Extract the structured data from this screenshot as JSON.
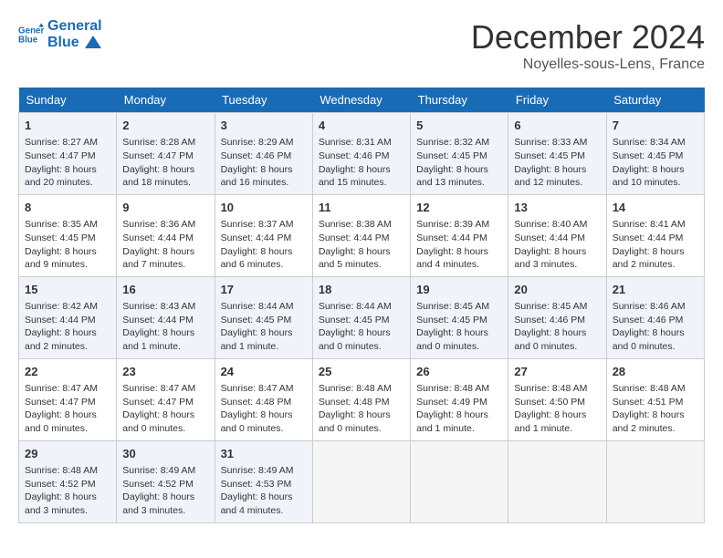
{
  "header": {
    "logo_line1": "General",
    "logo_line2": "Blue",
    "month": "December 2024",
    "location": "Noyelles-sous-Lens, France"
  },
  "days_of_week": [
    "Sunday",
    "Monday",
    "Tuesday",
    "Wednesday",
    "Thursday",
    "Friday",
    "Saturday"
  ],
  "weeks": [
    [
      {
        "day": "1",
        "sunrise": "8:27 AM",
        "sunset": "4:47 PM",
        "daylight": "8 hours and 20 minutes."
      },
      {
        "day": "2",
        "sunrise": "8:28 AM",
        "sunset": "4:47 PM",
        "daylight": "8 hours and 18 minutes."
      },
      {
        "day": "3",
        "sunrise": "8:29 AM",
        "sunset": "4:46 PM",
        "daylight": "8 hours and 16 minutes."
      },
      {
        "day": "4",
        "sunrise": "8:31 AM",
        "sunset": "4:46 PM",
        "daylight": "8 hours and 15 minutes."
      },
      {
        "day": "5",
        "sunrise": "8:32 AM",
        "sunset": "4:45 PM",
        "daylight": "8 hours and 13 minutes."
      },
      {
        "day": "6",
        "sunrise": "8:33 AM",
        "sunset": "4:45 PM",
        "daylight": "8 hours and 12 minutes."
      },
      {
        "day": "7",
        "sunrise": "8:34 AM",
        "sunset": "4:45 PM",
        "daylight": "8 hours and 10 minutes."
      }
    ],
    [
      {
        "day": "8",
        "sunrise": "8:35 AM",
        "sunset": "4:45 PM",
        "daylight": "8 hours and 9 minutes."
      },
      {
        "day": "9",
        "sunrise": "8:36 AM",
        "sunset": "4:44 PM",
        "daylight": "8 hours and 7 minutes."
      },
      {
        "day": "10",
        "sunrise": "8:37 AM",
        "sunset": "4:44 PM",
        "daylight": "8 hours and 6 minutes."
      },
      {
        "day": "11",
        "sunrise": "8:38 AM",
        "sunset": "4:44 PM",
        "daylight": "8 hours and 5 minutes."
      },
      {
        "day": "12",
        "sunrise": "8:39 AM",
        "sunset": "4:44 PM",
        "daylight": "8 hours and 4 minutes."
      },
      {
        "day": "13",
        "sunrise": "8:40 AM",
        "sunset": "4:44 PM",
        "daylight": "8 hours and 3 minutes."
      },
      {
        "day": "14",
        "sunrise": "8:41 AM",
        "sunset": "4:44 PM",
        "daylight": "8 hours and 2 minutes."
      }
    ],
    [
      {
        "day": "15",
        "sunrise": "8:42 AM",
        "sunset": "4:44 PM",
        "daylight": "8 hours and 2 minutes."
      },
      {
        "day": "16",
        "sunrise": "8:43 AM",
        "sunset": "4:44 PM",
        "daylight": "8 hours and 1 minute."
      },
      {
        "day": "17",
        "sunrise": "8:44 AM",
        "sunset": "4:45 PM",
        "daylight": "8 hours and 1 minute."
      },
      {
        "day": "18",
        "sunrise": "8:44 AM",
        "sunset": "4:45 PM",
        "daylight": "8 hours and 0 minutes."
      },
      {
        "day": "19",
        "sunrise": "8:45 AM",
        "sunset": "4:45 PM",
        "daylight": "8 hours and 0 minutes."
      },
      {
        "day": "20",
        "sunrise": "8:45 AM",
        "sunset": "4:46 PM",
        "daylight": "8 hours and 0 minutes."
      },
      {
        "day": "21",
        "sunrise": "8:46 AM",
        "sunset": "4:46 PM",
        "daylight": "8 hours and 0 minutes."
      }
    ],
    [
      {
        "day": "22",
        "sunrise": "8:47 AM",
        "sunset": "4:47 PM",
        "daylight": "8 hours and 0 minutes."
      },
      {
        "day": "23",
        "sunrise": "8:47 AM",
        "sunset": "4:47 PM",
        "daylight": "8 hours and 0 minutes."
      },
      {
        "day": "24",
        "sunrise": "8:47 AM",
        "sunset": "4:48 PM",
        "daylight": "8 hours and 0 minutes."
      },
      {
        "day": "25",
        "sunrise": "8:48 AM",
        "sunset": "4:48 PM",
        "daylight": "8 hours and 0 minutes."
      },
      {
        "day": "26",
        "sunrise": "8:48 AM",
        "sunset": "4:49 PM",
        "daylight": "8 hours and 1 minute."
      },
      {
        "day": "27",
        "sunrise": "8:48 AM",
        "sunset": "4:50 PM",
        "daylight": "8 hours and 1 minute."
      },
      {
        "day": "28",
        "sunrise": "8:48 AM",
        "sunset": "4:51 PM",
        "daylight": "8 hours and 2 minutes."
      }
    ],
    [
      {
        "day": "29",
        "sunrise": "8:48 AM",
        "sunset": "4:52 PM",
        "daylight": "8 hours and 3 minutes."
      },
      {
        "day": "30",
        "sunrise": "8:49 AM",
        "sunset": "4:52 PM",
        "daylight": "8 hours and 3 minutes."
      },
      {
        "day": "31",
        "sunrise": "8:49 AM",
        "sunset": "4:53 PM",
        "daylight": "8 hours and 4 minutes."
      },
      null,
      null,
      null,
      null
    ]
  ],
  "labels": {
    "sunrise": "Sunrise:",
    "sunset": "Sunset:",
    "daylight": "Daylight:"
  }
}
